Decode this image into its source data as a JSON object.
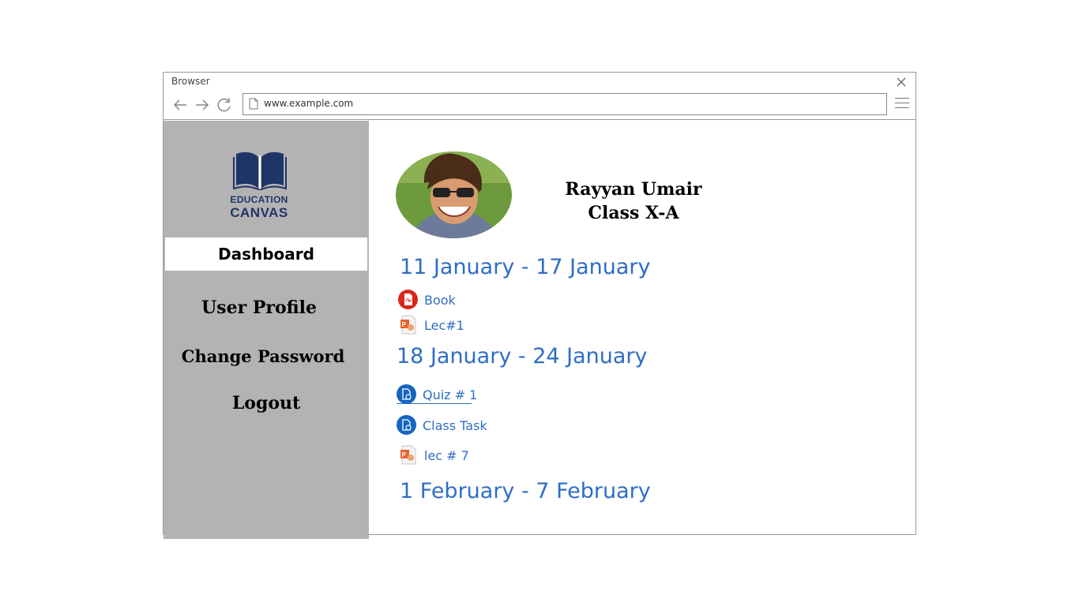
{
  "browser": {
    "title": "Browser",
    "url": "www.example.com"
  },
  "logo": {
    "line1": "EDUCATION",
    "line2": "CANVAS"
  },
  "sidebar": {
    "items": [
      {
        "label": "Dashboard",
        "active": true
      },
      {
        "label": "User Profile"
      },
      {
        "label": "Change Password"
      },
      {
        "label": "Logout"
      }
    ]
  },
  "profile": {
    "name": "Rayyan Umair",
    "class": "Class X-A"
  },
  "weeks": [
    {
      "title": "11 January - 17 January",
      "items": [
        {
          "label": "Book",
          "icon": "pdf-icon"
        },
        {
          "label": "Lec#1",
          "icon": "powerpoint-icon"
        }
      ]
    },
    {
      "title": "18 January - 24 January",
      "items": [
        {
          "label": "Quiz # 1",
          "icon": "assignment-icon"
        },
        {
          "label": "Class Task",
          "icon": "assignment-icon"
        },
        {
          "label": "lec # 7",
          "icon": "powerpoint-icon"
        }
      ]
    },
    {
      "title": "1 February - 7 February",
      "items": []
    }
  ],
  "colors": {
    "accent": "#2e6ec3",
    "sidebar": "#b3b3b3",
    "logo": "#1f3566",
    "pdf": "#d9261c",
    "assignment": "#1565c0"
  }
}
